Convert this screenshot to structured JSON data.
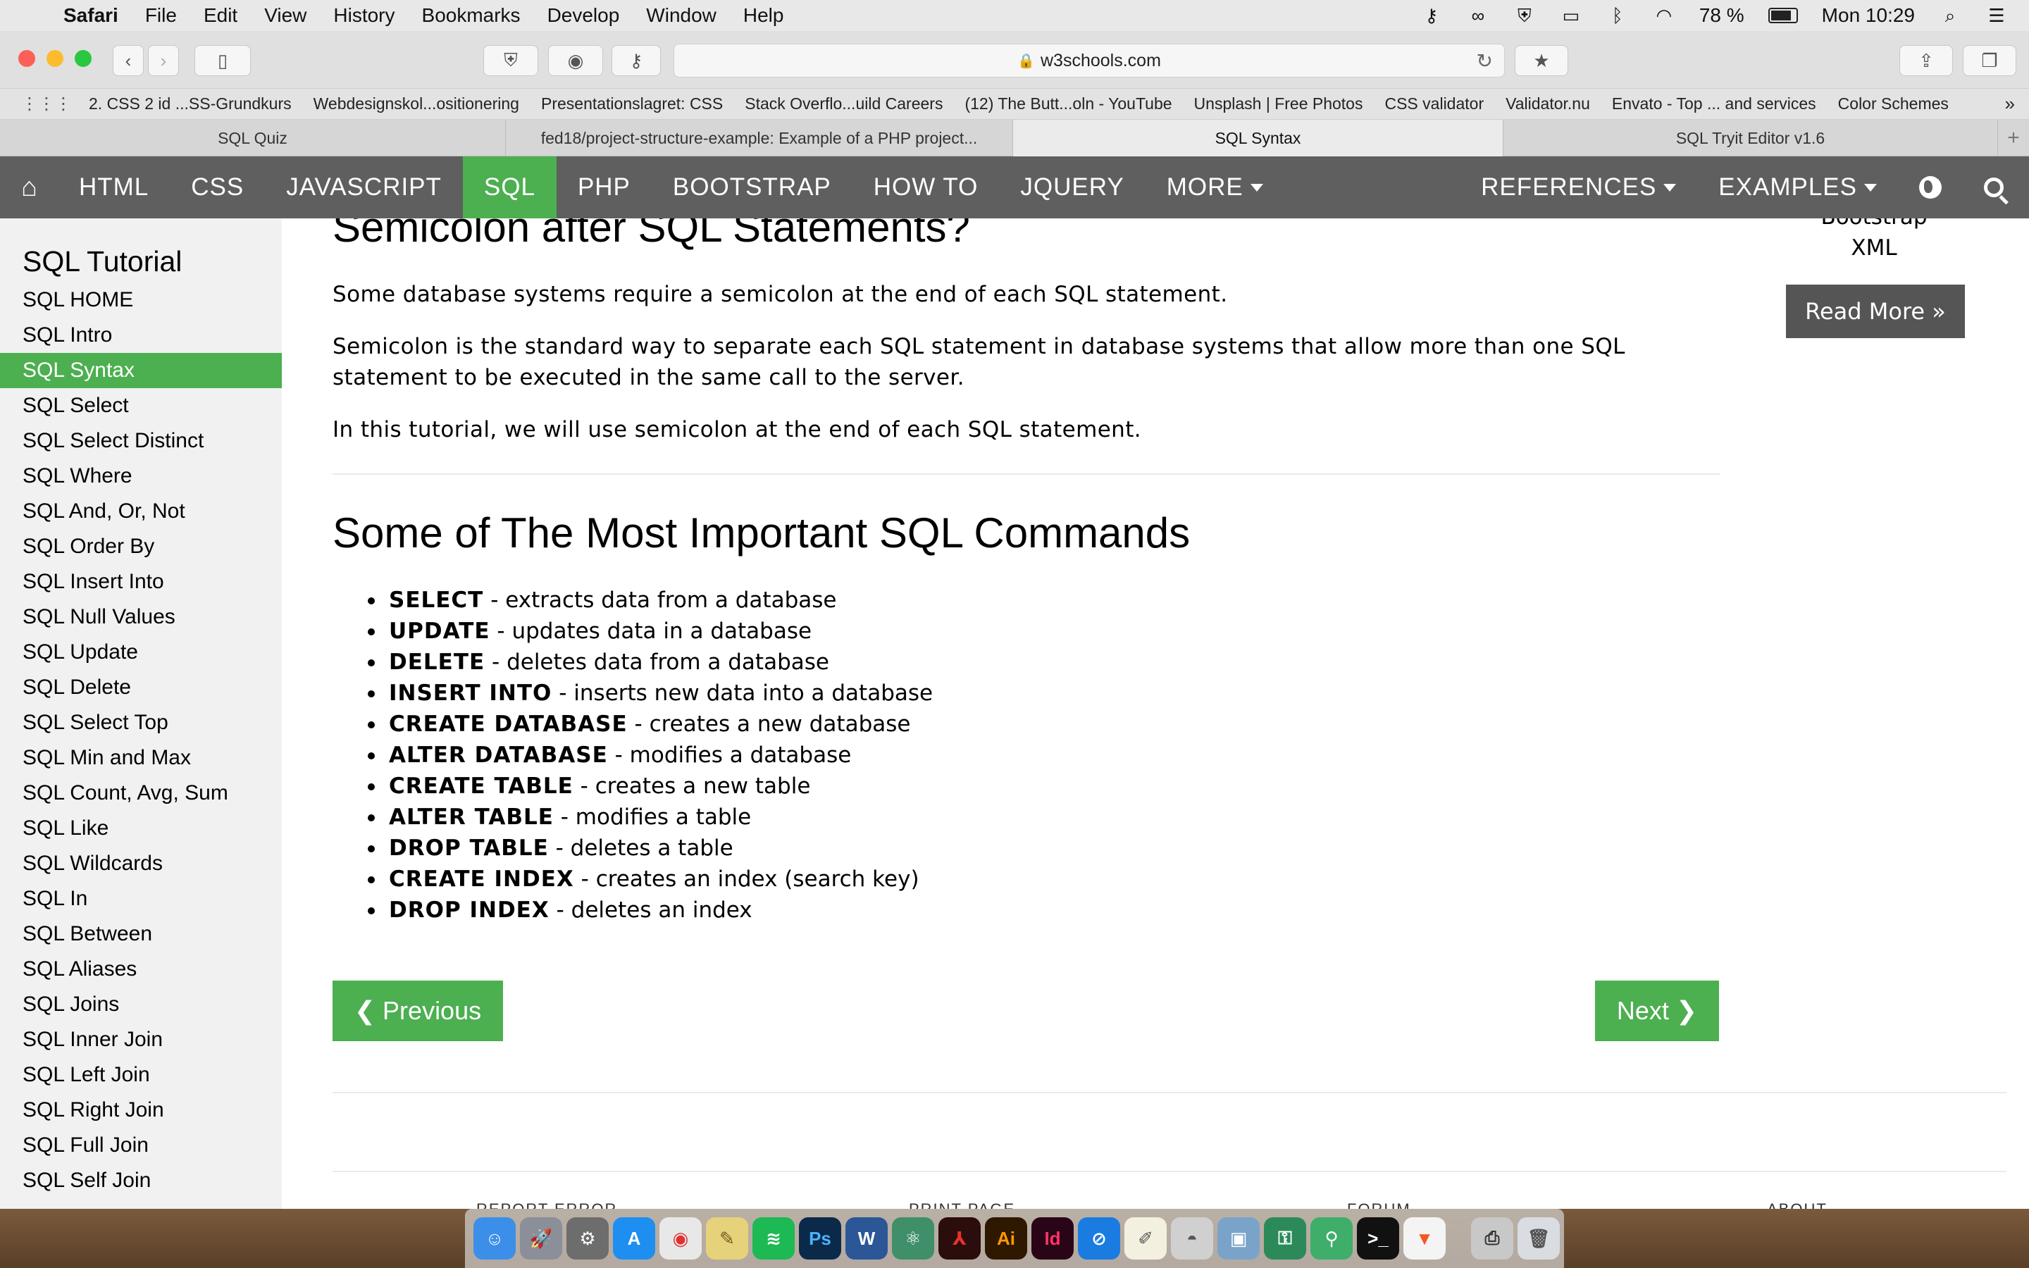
{
  "menubar": {
    "app": "Safari",
    "items": [
      "File",
      "Edit",
      "View",
      "History",
      "Bookmarks",
      "Develop",
      "Window",
      "Help"
    ],
    "battery": "78 %",
    "clock": "Mon 10:29"
  },
  "toolbar": {
    "url": "w3schools.com"
  },
  "bookmarks": [
    "2. CSS 2 id ...SS-Grundkurs",
    "Webdesignskol...ositionering",
    "Presentationslagret: CSS",
    "Stack Overflo...uild Careers",
    "(12) The Butt...oln - YouTube",
    "Unsplash | Free Photos",
    "CSS validator",
    "Validator.nu",
    "Envato - Top ... and services",
    "Color Schemes"
  ],
  "tabs": [
    "SQL Quiz",
    "fed18/project-structure-example: Example of a PHP project...",
    "SQL Syntax",
    "SQL Tryit Editor v1.6"
  ],
  "topnav": {
    "items": [
      "HTML",
      "CSS",
      "JAVASCRIPT",
      "SQL",
      "PHP",
      "BOOTSTRAP",
      "HOW TO",
      "JQUERY",
      "MORE"
    ],
    "right": [
      "REFERENCES",
      "EXAMPLES"
    ]
  },
  "sidebar": {
    "title": "SQL Tutorial",
    "items": [
      "SQL HOME",
      "SQL Intro",
      "SQL Syntax",
      "SQL Select",
      "SQL Select Distinct",
      "SQL Where",
      "SQL And, Or, Not",
      "SQL Order By",
      "SQL Insert Into",
      "SQL Null Values",
      "SQL Update",
      "SQL Delete",
      "SQL Select Top",
      "SQL Min and Max",
      "SQL Count, Avg, Sum",
      "SQL Like",
      "SQL Wildcards",
      "SQL In",
      "SQL Between",
      "SQL Aliases",
      "SQL Joins",
      "SQL Inner Join",
      "SQL Left Join",
      "SQL Right Join",
      "SQL Full Join",
      "SQL Self Join"
    ]
  },
  "main": {
    "top_heading": "Semicolon after SQL Statements?",
    "p1": "Some database systems require a semicolon at the end of each SQL statement.",
    "p2": "Semicolon is the standard way to separate each SQL statement in database systems that allow more than one SQL statement to be executed in the same call to the server.",
    "p3": "In this tutorial, we will use semicolon at the end of each SQL statement.",
    "heading": "Some of The Most Important SQL Commands",
    "commands": [
      {
        "cmd": "SELECT",
        "desc": " - extracts data from a database"
      },
      {
        "cmd": "UPDATE",
        "desc": " - updates data in a database"
      },
      {
        "cmd": "DELETE",
        "desc": " - deletes data from a database"
      },
      {
        "cmd": "INSERT INTO",
        "desc": " - inserts new data into a database"
      },
      {
        "cmd": "CREATE DATABASE",
        "desc": " - creates a new database"
      },
      {
        "cmd": "ALTER DATABASE",
        "desc": " - modifies a database"
      },
      {
        "cmd": "CREATE TABLE",
        "desc": " - creates a new table"
      },
      {
        "cmd": "ALTER TABLE",
        "desc": " - modifies a table"
      },
      {
        "cmd": "DROP TABLE",
        "desc": " - deletes a table"
      },
      {
        "cmd": "CREATE INDEX",
        "desc": " - creates an index (search key)"
      },
      {
        "cmd": "DROP INDEX",
        "desc": " - deletes an index"
      }
    ],
    "prev": "❮ Previous",
    "next": "Next ❯"
  },
  "rightcol": {
    "line1": "Bootstrap",
    "line2": "XML",
    "readmore": "Read More »"
  },
  "footer": [
    "REPORT ERROR",
    "PRINT PAGE",
    "FORUM",
    "ABOUT"
  ],
  "dock_icons": [
    "finder-icon",
    "launchpad-icon",
    "system-preferences-icon",
    "app-store-icon",
    "chrome-icon",
    "stickies-icon",
    "spotify-icon",
    "photoshop-icon",
    "word-icon",
    "atom-icon",
    "acrobat-icon",
    "illustrator-icon",
    "indesign-icon",
    "safari-icon",
    "textedit-icon",
    "sequel-pro-icon",
    "preview-icon",
    "keychain-icon",
    "keys-icon",
    "terminal-icon",
    "brave-icon",
    "printer-icon",
    "trash-icon"
  ]
}
